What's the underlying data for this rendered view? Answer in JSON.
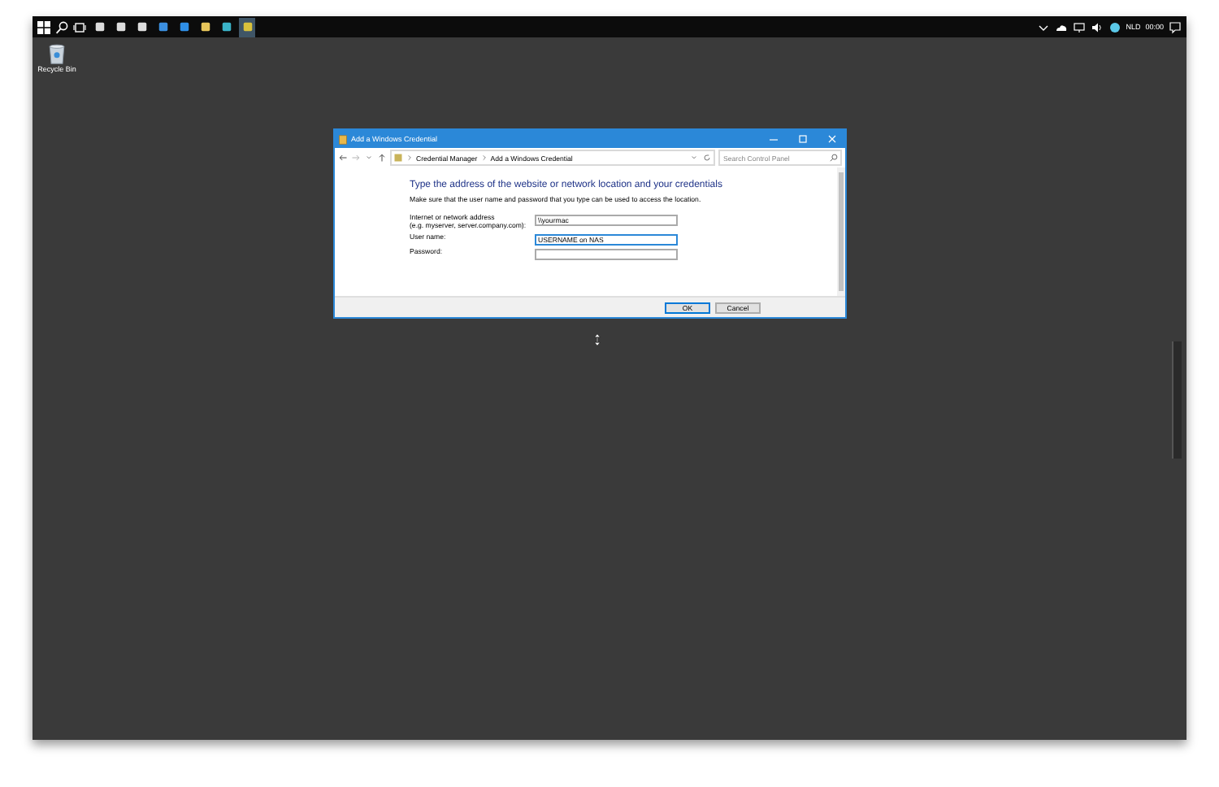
{
  "taskbar": {
    "apps": [
      {
        "selected": false
      },
      {
        "selected": false
      },
      {
        "selected": false
      },
      {
        "selected": false
      },
      {
        "selected": false
      },
      {
        "selected": false
      },
      {
        "selected": false
      },
      {
        "selected": true
      }
    ],
    "tray": {
      "language": "NLD",
      "time": "00:00"
    }
  },
  "desktop": {
    "icons": [
      {
        "label": "Recycle Bin"
      }
    ]
  },
  "window": {
    "title": "Add a Windows Credential",
    "breadcrumb": [
      "Credential Manager",
      "Add a Windows Credential"
    ],
    "search": {
      "placeholder": "Search Control Panel"
    },
    "heading": "Type the address of the website or network location and your credentials",
    "description": "Make sure that the user name and password that you type can be used to access the location.",
    "fields": [
      {
        "label": [
          "Internet or network address",
          "(e.g. myserver, server.company.com):"
        ],
        "value": "\\\\yourmac",
        "focused": false
      },
      {
        "label": [
          "User name:"
        ],
        "value": "USERNAME on NAS",
        "focused": true
      },
      {
        "label": [
          "Password:"
        ],
        "focused": false
      }
    ],
    "buttons": [
      {
        "label": "OK",
        "default": true
      },
      {
        "label": "Cancel",
        "default": false
      }
    ]
  }
}
